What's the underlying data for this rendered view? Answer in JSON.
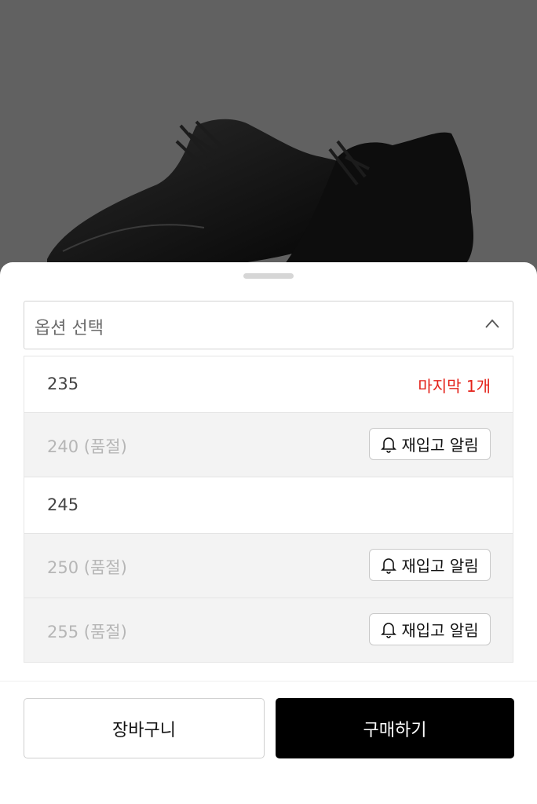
{
  "option_select": {
    "label": "옵션 선택",
    "icon": "chevron-up-icon"
  },
  "options": [
    {
      "label": "235",
      "note": "마지막 1개"
    },
    {
      "label": "240 (품절)",
      "restock_label": "재입고 알림"
    },
    {
      "label": "245"
    },
    {
      "label": "250 (품절)",
      "restock_label": "재입고 알림"
    },
    {
      "label": "255 (품절)",
      "restock_label": "재입고 알림"
    }
  ],
  "actions": {
    "cart_label": "장바구니",
    "buy_label": "구매하기"
  },
  "colors": {
    "accent_red": "#e4231b",
    "buy_button": "#000000",
    "overlay": "#616161"
  }
}
